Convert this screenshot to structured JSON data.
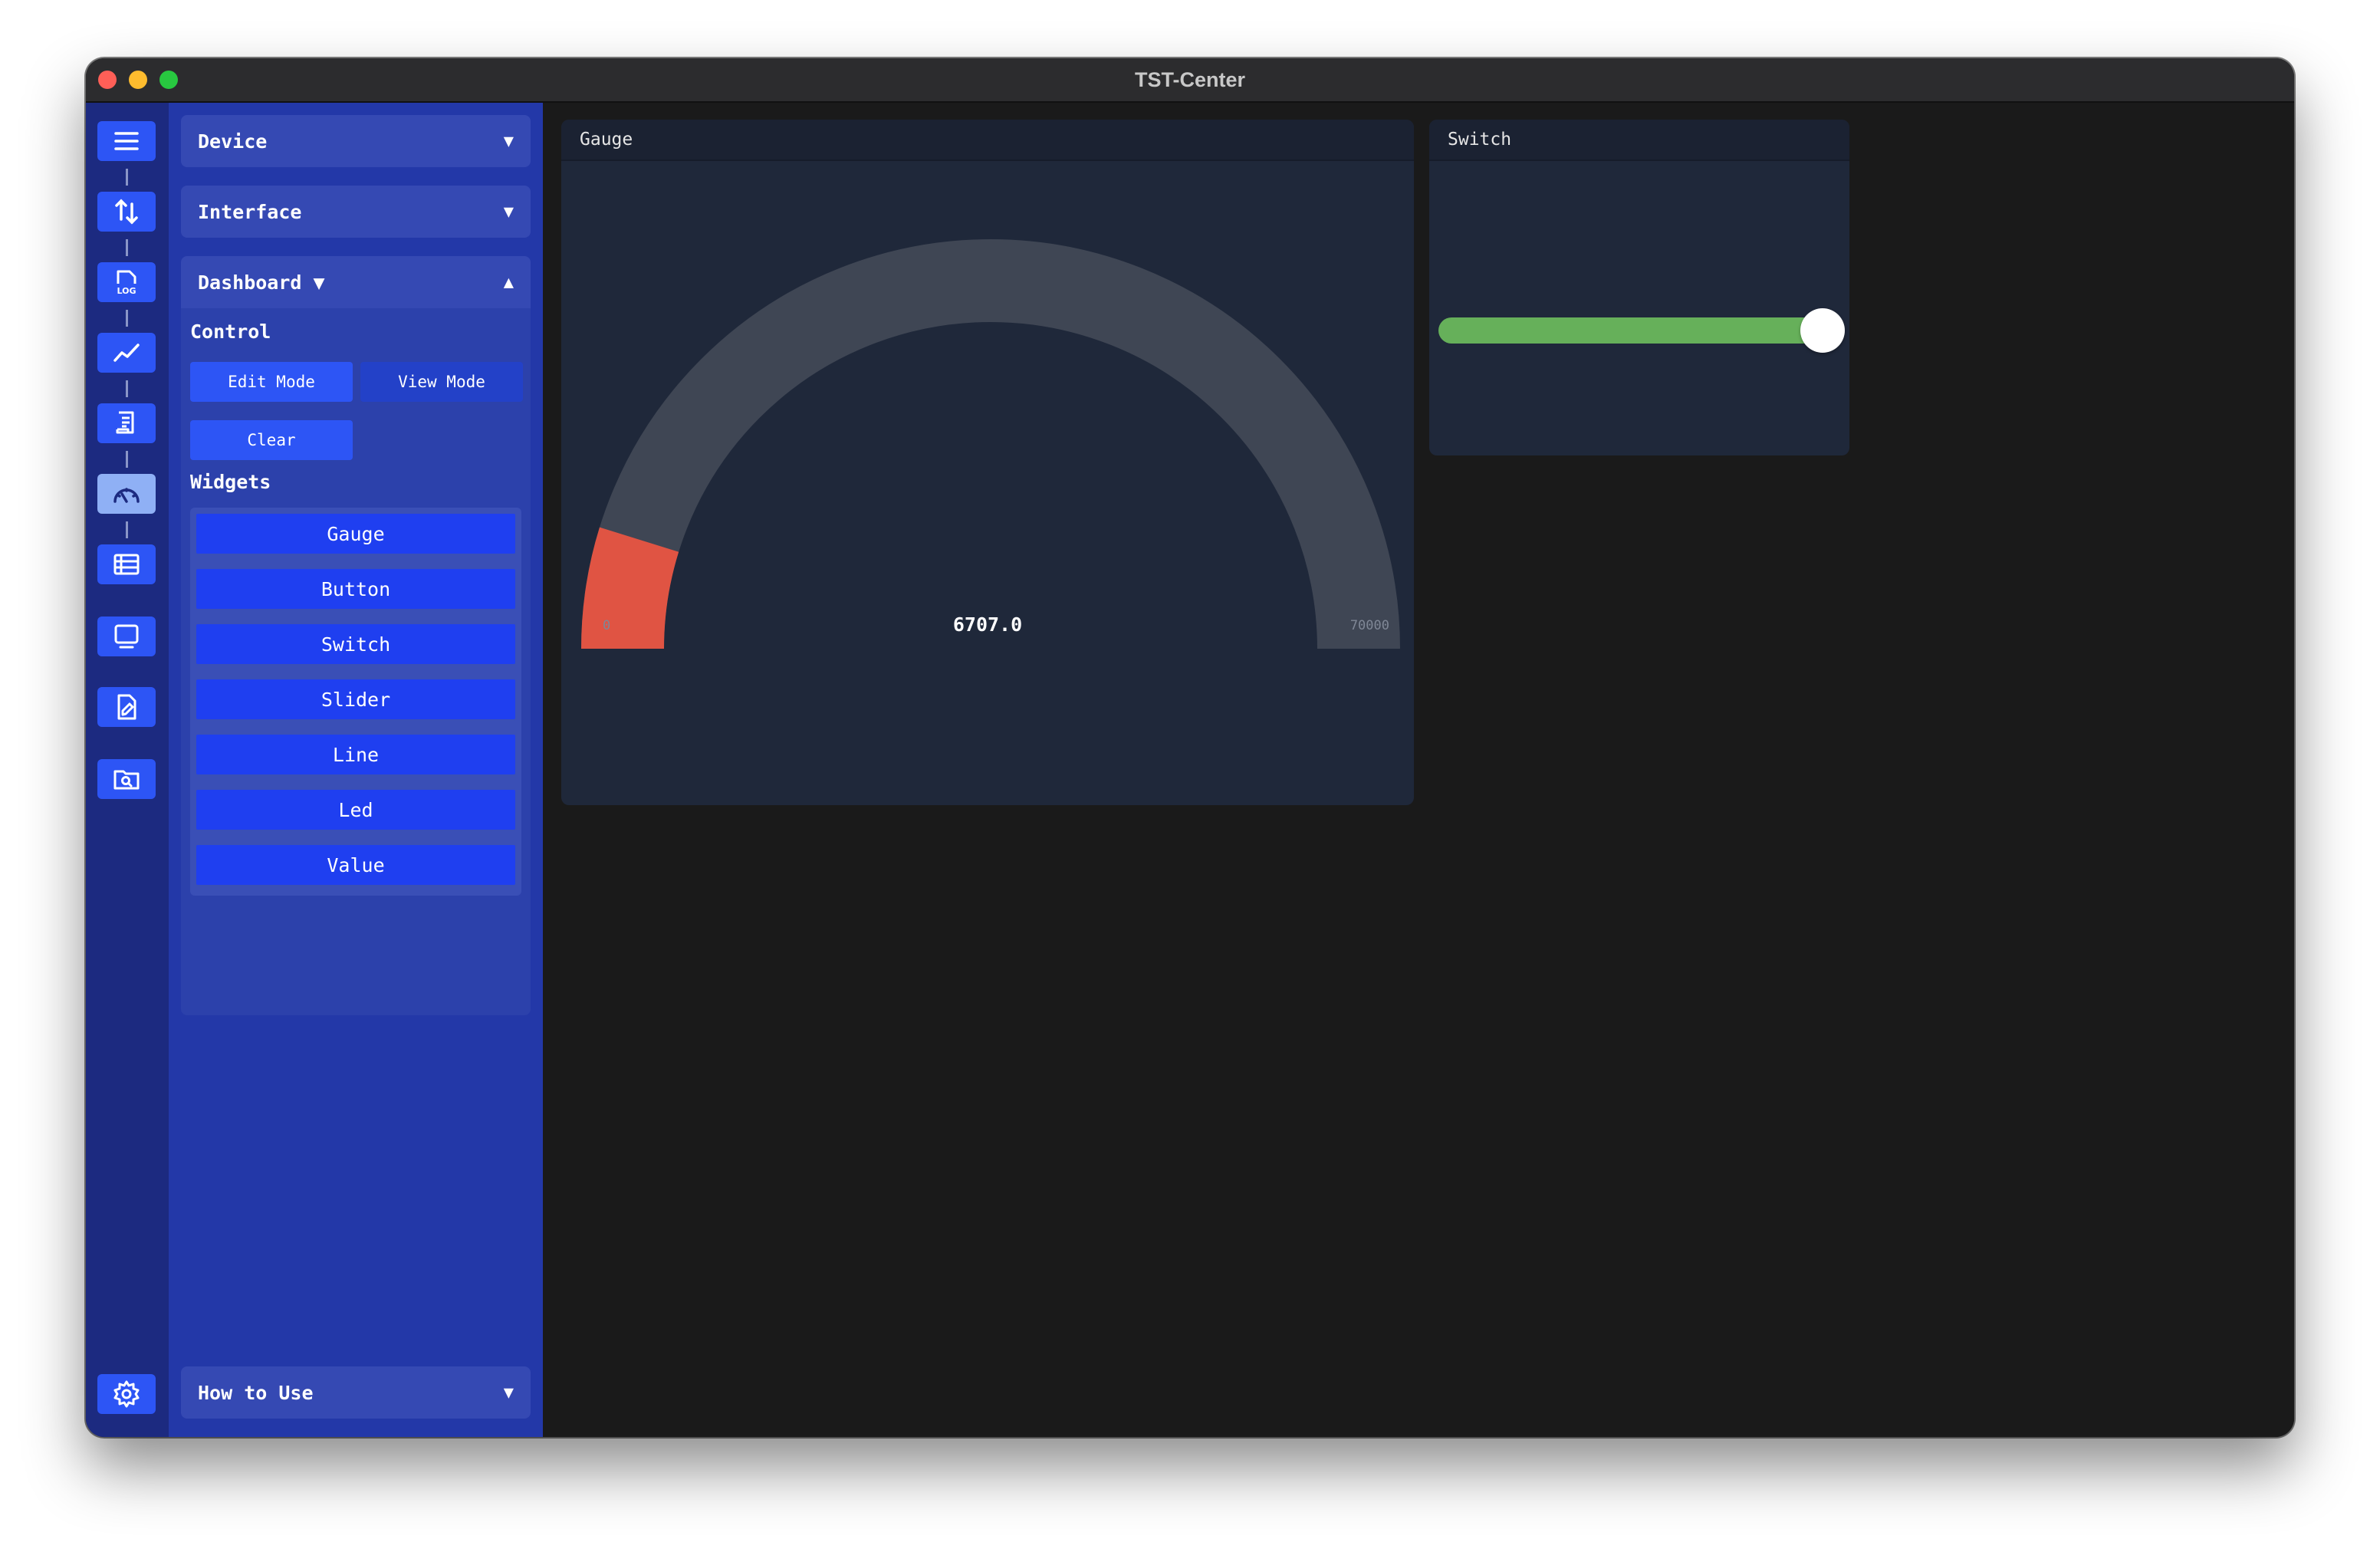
{
  "window": {
    "title": "TST-Center"
  },
  "rail": {
    "items": [
      {
        "icon": "menu-icon"
      },
      {
        "icon": "transfer-arrows-icon"
      },
      {
        "icon": "log-file-icon",
        "label": "LOG"
      },
      {
        "icon": "line-chart-icon"
      },
      {
        "icon": "script-icon"
      },
      {
        "icon": "dashboard-gauge-icon",
        "active": true
      },
      {
        "icon": "table-icon"
      },
      {
        "icon": "monitor-icon"
      },
      {
        "icon": "file-edit-icon"
      },
      {
        "icon": "folder-search-icon"
      }
    ],
    "settings_icon": "gear-icon"
  },
  "panel": {
    "device": {
      "label": "Device",
      "arrow": "▼"
    },
    "interface": {
      "label": "Interface",
      "arrow": "▼"
    },
    "dashboard": {
      "label": "Dashboard ▼",
      "arrow": "▲"
    },
    "control_label": "Control",
    "edit_mode": "Edit Mode",
    "view_mode": "View Mode",
    "clear": "Clear",
    "widgets_label": "Widgets",
    "widgets": [
      "Gauge",
      "Button",
      "Switch",
      "Slider",
      "Line",
      "Led",
      "Value"
    ],
    "how_to_use": {
      "label": "How to Use",
      "arrow": "▼"
    }
  },
  "gauge_card": {
    "title": "Gauge",
    "min_label": "0",
    "max_label": "70000",
    "value_label": "6707.0",
    "value": 6707.0,
    "min": 0,
    "max": 70000,
    "fill_color": "#e05443",
    "track_color": "#3f4654"
  },
  "switch_card": {
    "title": "Switch",
    "on": true,
    "track_color": "#66b05a"
  }
}
